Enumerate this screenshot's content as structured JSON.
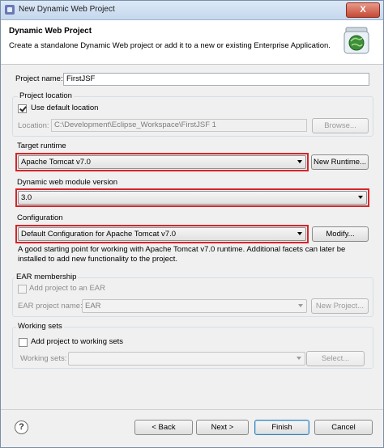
{
  "window": {
    "title": "New Dynamic Web Project",
    "close_glyph": "X"
  },
  "header": {
    "title": "Dynamic Web Project",
    "description": "Create a standalone Dynamic Web project or add it to a new or existing Enterprise Application."
  },
  "project_name": {
    "label": "Project name:",
    "value": "FirstJSF"
  },
  "location": {
    "group_label": "Project location",
    "use_default_label": "Use default location",
    "use_default_checked": true,
    "location_label": "Location:",
    "location_value": "C:\\Development\\Eclipse_Workspace\\FirstJSF 1",
    "browse_label": "Browse..."
  },
  "target_runtime": {
    "label": "Target runtime",
    "value": "Apache Tomcat v7.0",
    "new_runtime_label": "New Runtime..."
  },
  "module_version": {
    "label": "Dynamic web module version",
    "value": "3.0"
  },
  "configuration": {
    "label": "Configuration",
    "value": "Default Configuration for Apache Tomcat v7.0",
    "modify_label": "Modify...",
    "description": "A good starting point for working with Apache Tomcat v7.0 runtime. Additional facets can later be installed to add new functionality to the project."
  },
  "ear": {
    "group_label": "EAR membership",
    "add_label": "Add project to an EAR",
    "add_checked": false,
    "name_label": "EAR project name:",
    "name_value": "EAR",
    "new_project_label": "New Project..."
  },
  "working_sets": {
    "group_label": "Working sets",
    "add_label": "Add project to working sets",
    "add_checked": false,
    "sets_label": "Working sets:",
    "sets_value": "",
    "select_label": "Select..."
  },
  "footer": {
    "help_glyph": "?",
    "back_label": "< Back",
    "next_label": "Next >",
    "finish_label": "Finish",
    "cancel_label": "Cancel"
  },
  "colors": {
    "highlight": "#d4262b",
    "titlebar": "#c6d8ee",
    "dialog_bg": "#f0f0f0"
  }
}
